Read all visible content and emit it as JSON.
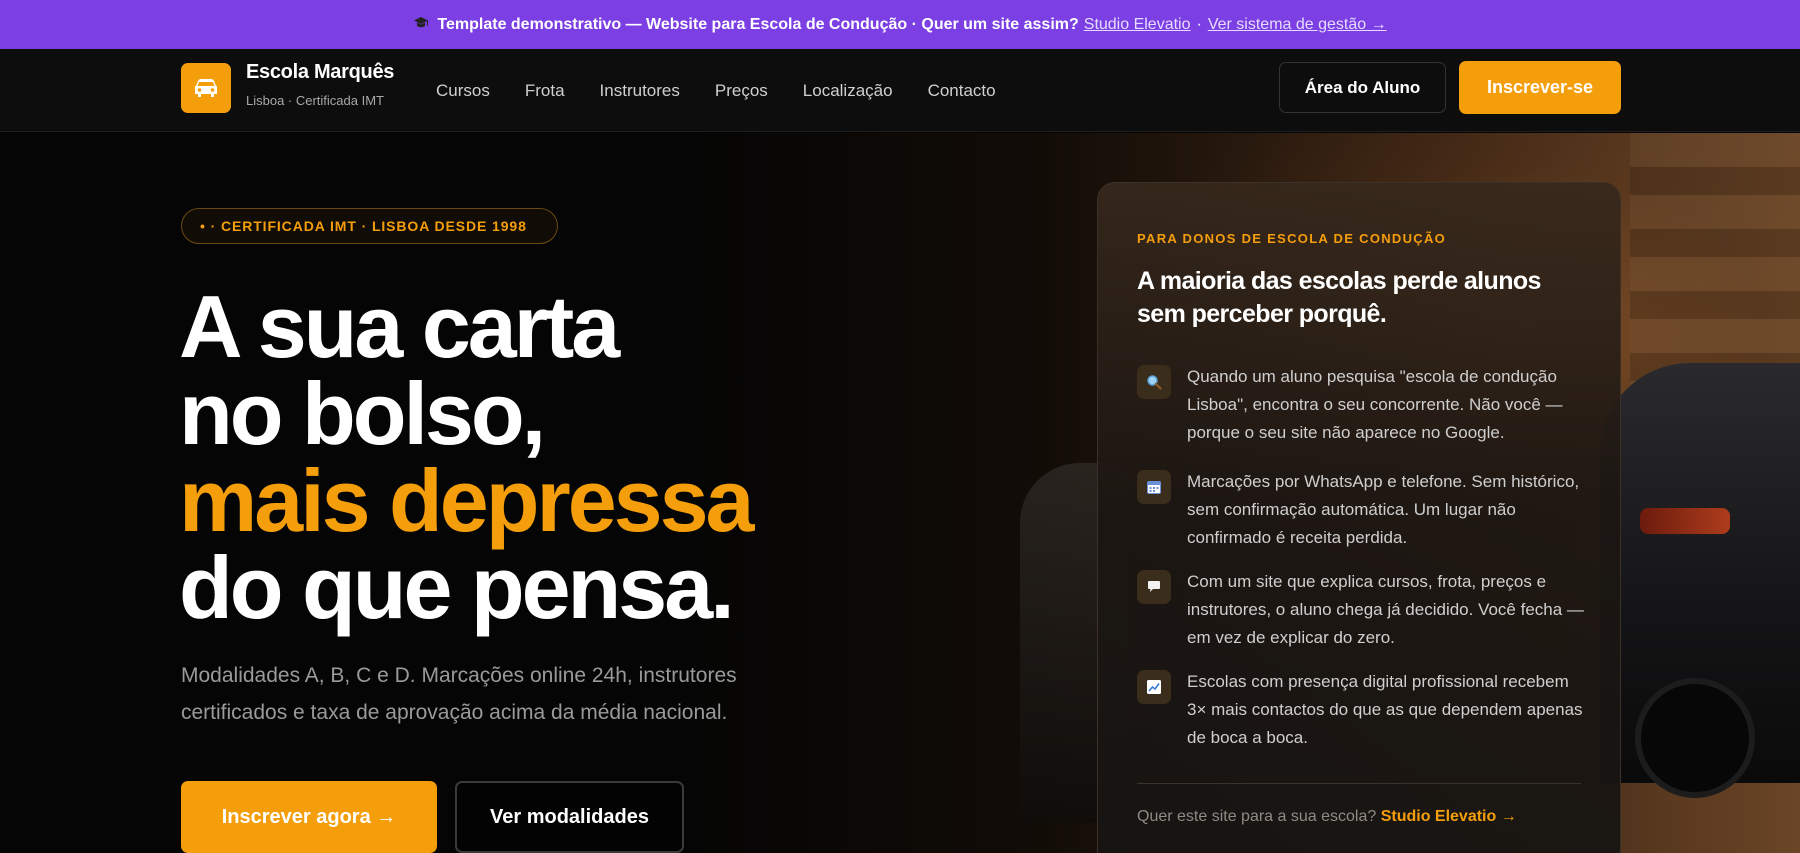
{
  "topbar": {
    "icon": "graduation-cap-icon",
    "text": "Template demonstrativo — Website para Escola de Condução · Quer um site assim?",
    "link1": "Studio Elevatio",
    "separator": "·",
    "link2": "Ver sistema de gestão →",
    "bg_color": "#7b3fe4"
  },
  "header": {
    "logo_icon": "car-icon",
    "brand_name": "Escola Marquês",
    "brand_sub": "Lisboa · Certificada IMT",
    "nav": [
      "Cursos",
      "Frota",
      "Instrutores",
      "Preços",
      "Localização",
      "Contacto"
    ],
    "area_button": "Área do Aluno",
    "signup_button": "Inscrever-se"
  },
  "hero": {
    "badge": "• · CERTIFICADA IMT · LISBOA DESDE 1998",
    "headline": {
      "line1": "A sua carta",
      "line2": "no bolso,",
      "line3": "mais depressa",
      "line4": "do que pensa."
    },
    "subtitle": "Modalidades A, B, C e D. Marcações online 24h, instrutores certificados e taxa de aprovação acima da média nacional.",
    "cta_primary": "Inscrever agora →",
    "cta_secondary": "Ver modalidades",
    "accent_color": "#f59e0b"
  },
  "card": {
    "eyebrow": "PARA DONOS DE ESCOLA DE CONDUÇÃO",
    "title": "A maioria das escolas perde alunos sem perceber porquê.",
    "points": [
      {
        "icon": "magnifier-icon",
        "text": "Quando um aluno pesquisa \"escola de condução Lisboa\", encontra o seu concorrente. Não você — porque o seu site não aparece no Google."
      },
      {
        "icon": "calendar-icon",
        "text": "Marcações por WhatsApp e telefone. Sem histórico, sem confirmação automática. Um lugar não confirmado é receita perdida."
      },
      {
        "icon": "speech-bubble-icon",
        "text": "Com um site que explica cursos, frota, preços e instrutores, o aluno chega já decidido. Você fecha — em vez de explicar do zero."
      },
      {
        "icon": "chart-up-icon",
        "text": "Escolas com presença digital profissional recebem 3× mais contactos do que as que dependem apenas de boca a boca."
      }
    ],
    "footer_text": "Quer este site para a sua escola?",
    "footer_link": "Studio Elevatio →"
  }
}
